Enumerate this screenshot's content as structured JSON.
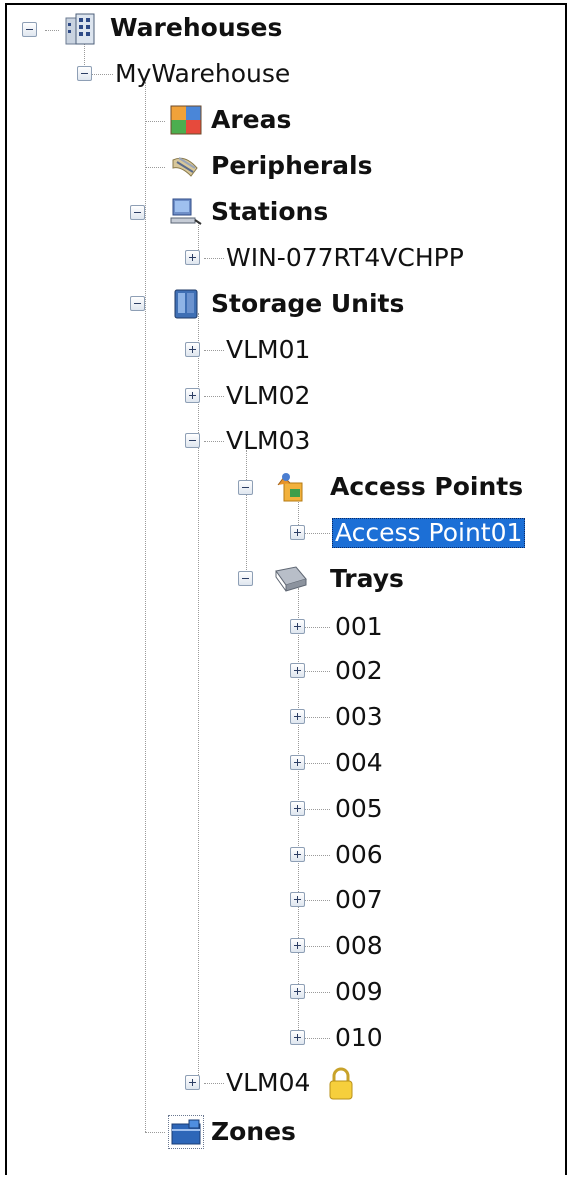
{
  "tree": {
    "root": {
      "label": "Warehouses",
      "icon": "building-icon"
    },
    "warehouse": {
      "label": "MyWarehouse"
    },
    "areas": {
      "label": "Areas",
      "icon": "areas-icon"
    },
    "peripherals": {
      "label": "Peripherals",
      "icon": "peripherals-icon"
    },
    "stations": {
      "label": "Stations",
      "icon": "computer-icon",
      "items": [
        {
          "label": "WIN-077RT4VCHPP"
        }
      ]
    },
    "storage_units": {
      "label": "Storage Units",
      "icon": "storage-unit-icon",
      "items": [
        {
          "label": "VLM01"
        },
        {
          "label": "VLM02"
        },
        {
          "label": "VLM03"
        },
        {
          "label": "VLM04",
          "badge_icon": "lock-icon"
        }
      ]
    },
    "access_points": {
      "label": "Access Points",
      "icon": "access-point-icon",
      "items": [
        {
          "label": "Access Point01",
          "selected": true
        }
      ]
    },
    "trays": {
      "label": "Trays",
      "icon": "tray-icon",
      "items": [
        {
          "label": "001"
        },
        {
          "label": "002"
        },
        {
          "label": "003"
        },
        {
          "label": "004"
        },
        {
          "label": "005"
        },
        {
          "label": "006"
        },
        {
          "label": "007"
        },
        {
          "label": "008"
        },
        {
          "label": "009"
        },
        {
          "label": "010"
        }
      ]
    },
    "zones": {
      "label": "Zones",
      "icon": "zones-icon"
    }
  },
  "colors": {
    "selection": "#1c6fd6",
    "tree_lines": "#9a9a9a",
    "expander_border": "#8e9fb5"
  }
}
